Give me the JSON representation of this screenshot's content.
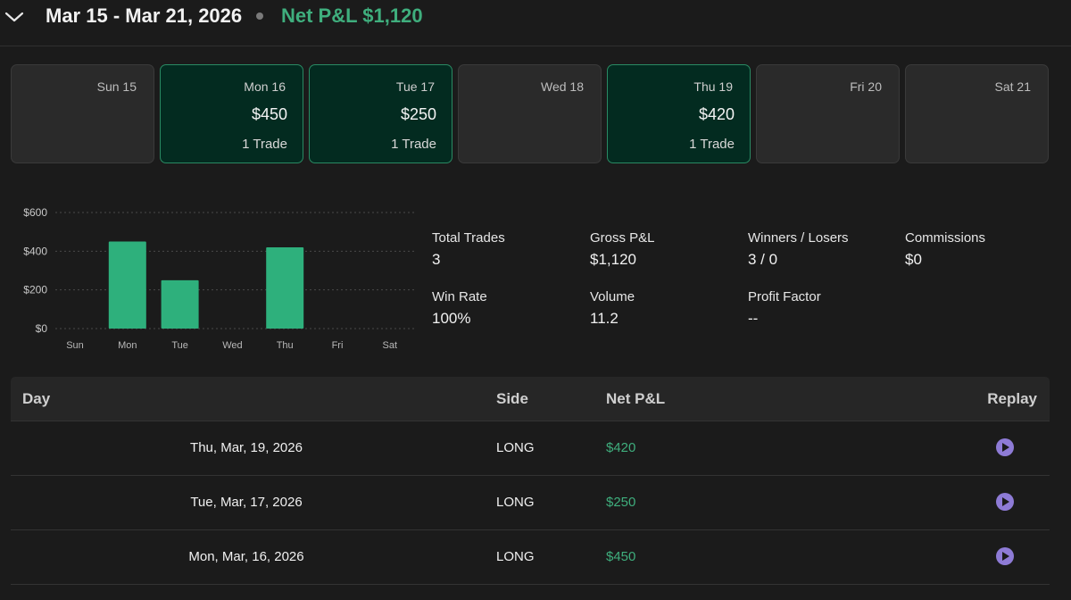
{
  "header": {
    "week_range": "Mar 15 - Mar 21, 2026",
    "net_pnl": "Net P&L $1,120",
    "collapse_icon": "chevron-down-icon",
    "accent_color": "#3fae7d"
  },
  "days": [
    {
      "label": "Sun 15",
      "amount": "",
      "trades": "",
      "status": "none"
    },
    {
      "label": "Mon 16",
      "amount": "$450",
      "trades": "1 Trade",
      "status": "win"
    },
    {
      "label": "Tue 17",
      "amount": "$250",
      "trades": "1 Trade",
      "status": "win"
    },
    {
      "label": "Wed 18",
      "amount": "",
      "trades": "",
      "status": "none"
    },
    {
      "label": "Thu 19",
      "amount": "$420",
      "trades": "1 Trade",
      "status": "win"
    },
    {
      "label": "Fri 20",
      "amount": "",
      "trades": "",
      "status": "none"
    },
    {
      "label": "Sat 21",
      "amount": "",
      "trades": "",
      "status": "none"
    }
  ],
  "chart_data": {
    "type": "bar",
    "categories": [
      "Sun",
      "Mon",
      "Tue",
      "Wed",
      "Thu",
      "Fri",
      "Sat"
    ],
    "values": [
      0,
      450,
      250,
      0,
      420,
      0,
      0
    ],
    "ylim": [
      0,
      600
    ],
    "y_ticks": [
      "$0",
      "$200",
      "$400",
      "$600"
    ],
    "grid": true,
    "bar_color": "#2eb07c"
  },
  "stats": {
    "total_trades": {
      "label": "Total Trades",
      "value": "3"
    },
    "gross_pnl": {
      "label": "Gross P&L",
      "value": "$1,120"
    },
    "winners_losers": {
      "label": "Winners / Losers",
      "value": "3 / 0"
    },
    "commissions": {
      "label": "Commissions",
      "value": "$0"
    },
    "win_rate": {
      "label": "Win Rate",
      "value": "100%"
    },
    "volume": {
      "label": "Volume",
      "value": "11.2"
    },
    "profit_factor": {
      "label": "Profit Factor",
      "value": "--"
    }
  },
  "table": {
    "headers": {
      "day": "Day",
      "side": "Side",
      "net_pnl": "Net P&L",
      "replay": "Replay"
    },
    "rows": [
      {
        "day": "Thu, Mar, 19, 2026",
        "side": "LONG",
        "net_pnl": "$420",
        "replay_icon": "play-circle-icon"
      },
      {
        "day": "Tue, Mar, 17, 2026",
        "side": "LONG",
        "net_pnl": "$250",
        "replay_icon": "play-circle-icon"
      },
      {
        "day": "Mon, Mar, 16, 2026",
        "side": "LONG",
        "net_pnl": "$450",
        "replay_icon": "play-circle-icon"
      }
    ],
    "replay_color": "#8e7bd6"
  }
}
